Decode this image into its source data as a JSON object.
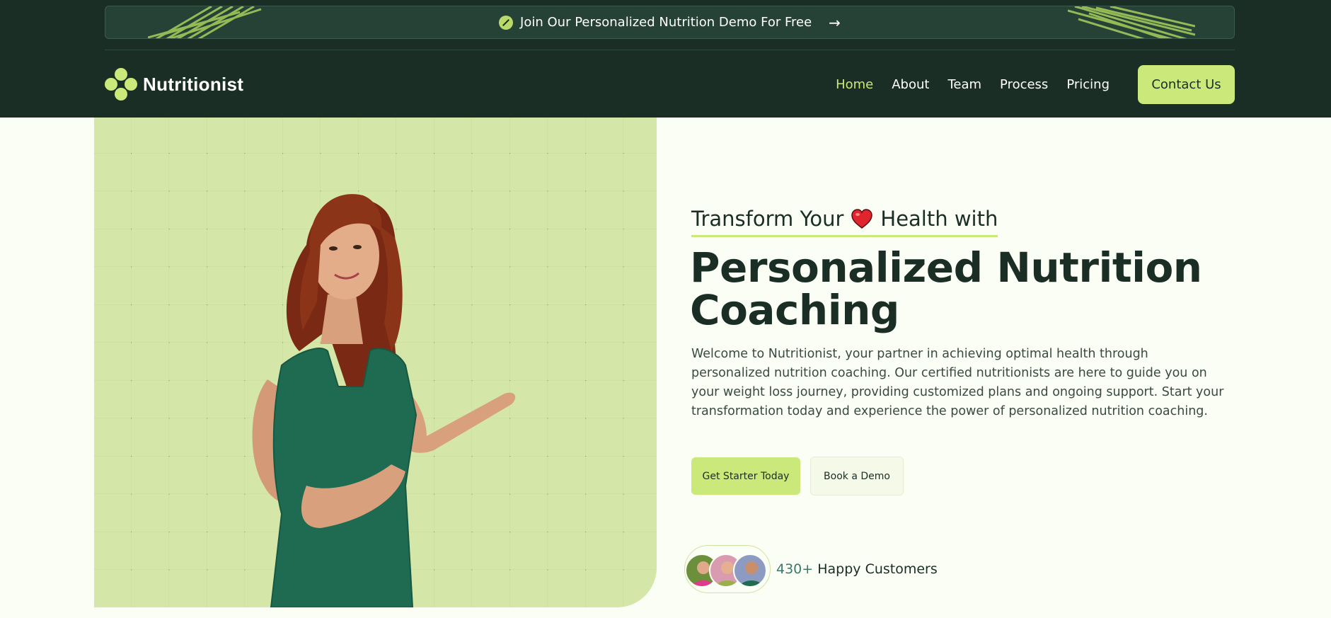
{
  "promo": {
    "text": "Join Our Personalized Nutrition Demo For Free",
    "arrow": "→",
    "icon": "leaf-badge-icon"
  },
  "brand": {
    "name": "Nutritionist",
    "accent": "#cbe87b",
    "dark": "#1a2e25"
  },
  "nav": {
    "items": [
      {
        "label": "Home",
        "active": true
      },
      {
        "label": "About"
      },
      {
        "label": "Team"
      },
      {
        "label": "Process"
      },
      {
        "label": "Pricing"
      }
    ],
    "contact_label": "Contact Us"
  },
  "hero": {
    "tagline_before": "Transform Your",
    "tagline_after": "Health with",
    "headline": "Personalized Nutrition Coaching",
    "description": "Welcome to Nutritionist, your partner in achieving optimal health through personalized nutrition coaching. Our certified nutritionists are here to guide you on your weight loss journey, providing customized plans and ongoing support. Start your transformation today and experience the power of personalized nutrition coaching.",
    "primary_button": "Get Starter Today",
    "secondary_button": "Book a Demo",
    "customers_count": "430+",
    "customers_label": "Happy Customers"
  }
}
